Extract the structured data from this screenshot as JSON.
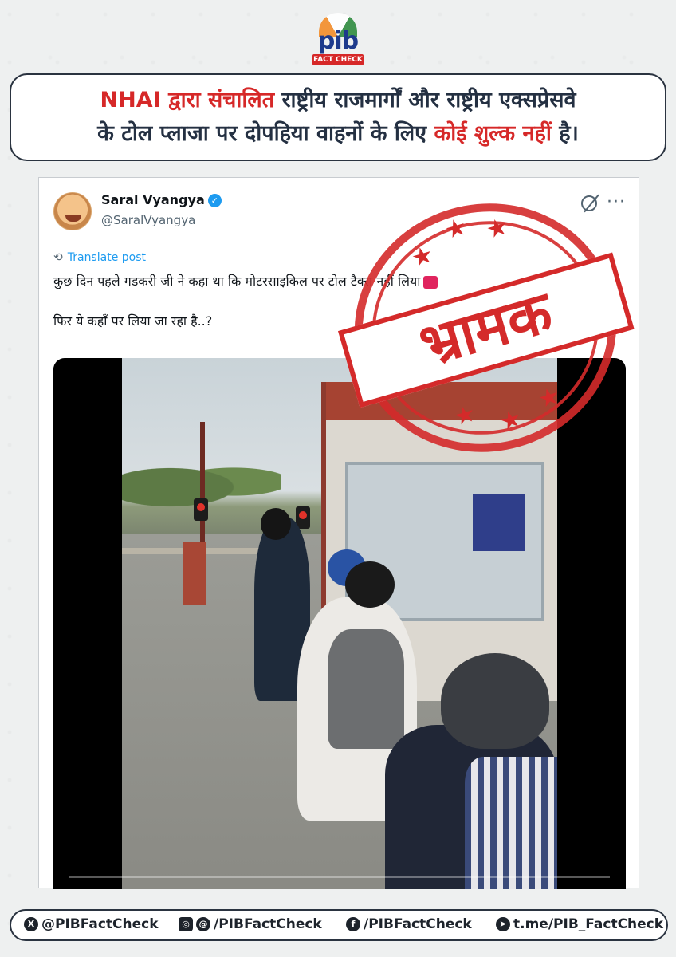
{
  "logo": {
    "text": "pib",
    "tag": "FACT CHECK"
  },
  "headline": {
    "line1_red": "NHAI द्वारा संचालित",
    "line1_rest": " राष्ट्रीय राजमार्गों और राष्ट्रीय एक्सप्रेसवे",
    "line2_start": "के टोल प्लाजा पर दोपहिया वाहनों के लिए ",
    "line2_red": "कोई शुल्क नहीं",
    "line2_end": " है।"
  },
  "post": {
    "author_name": "Saral Vyangya",
    "handle": "@SaralVyangya",
    "translate_label": "Translate post",
    "text_line1": "कुछ दिन पहले गडकरी जी ने कहा था कि मोटरसाइकिल पर टोल टैक्स नहीं लिया",
    "text_line2": "फिर ये कहाँ पर लिया जा रहा है..?",
    "video_progress": 0
  },
  "stamp": {
    "word": "भ्रामक"
  },
  "footer": {
    "x": "@PIBFactCheck",
    "insta_threads": "/PIBFactCheck",
    "facebook": "/PIBFactCheck",
    "telegram": "t.me/PIB_FactCheck"
  },
  "colors": {
    "accent_red": "#d62828",
    "verified_blue": "#1d9bf0",
    "dark": "#243042"
  }
}
